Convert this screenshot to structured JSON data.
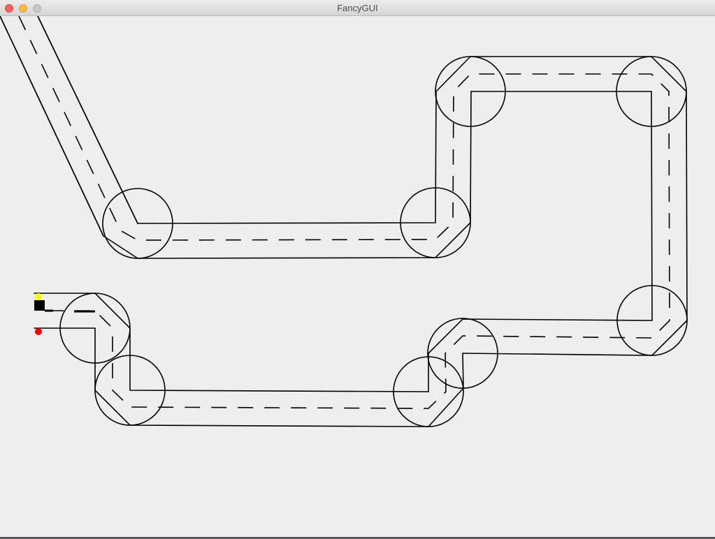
{
  "window": {
    "title": "FancyGUI",
    "controls": [
      "close-button",
      "minimize-button",
      "zoom-button"
    ]
  },
  "colors": {
    "background": "#eeeeee",
    "track_line": "#000000",
    "marker_yellow": "#ffff00",
    "marker_red": "#ff0000",
    "robot": "#000000"
  }
}
